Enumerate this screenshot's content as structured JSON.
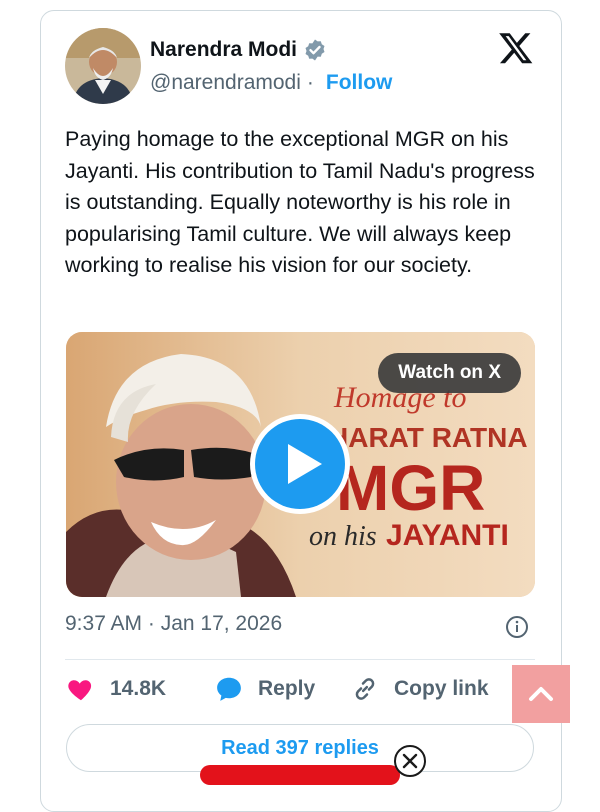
{
  "tweet": {
    "author_name": "Narendra Modi",
    "handle": "@narendramodi",
    "separator": "·",
    "follow_label": "Follow",
    "text": "Paying homage to the exceptional MGR on his Jayanti. His contribution to Tamil Nadu's progress is outstanding. Equally noteworthy is his role in popularising Tamil culture. We will always keep working to realise his vision for our society.",
    "timestamp": "9:37 AM · Jan 17, 2026"
  },
  "media": {
    "watch_label": "Watch on X",
    "overlay_line1": "Homage to",
    "overlay_line2": "HARAT RATNA",
    "overlay_line3": "MGR",
    "overlay_line4a": "on his",
    "overlay_line4b": "JAYANTI"
  },
  "actions": {
    "likes": "14.8K",
    "reply_label": "Reply",
    "copy_link_label": "Copy link"
  },
  "read_replies_label": "Read 397 replies",
  "icons": {
    "verified": "verified-badge-icon",
    "x_logo": "x-logo-icon",
    "like": "heart-icon",
    "reply": "speech-bubble-icon",
    "copy": "link-icon",
    "info": "info-icon",
    "scroll": "chevron-up-icon",
    "close": "close-icon"
  },
  "colors": {
    "accent": "#1d9bf0",
    "heart": "#f91880",
    "muted": "#536471"
  }
}
